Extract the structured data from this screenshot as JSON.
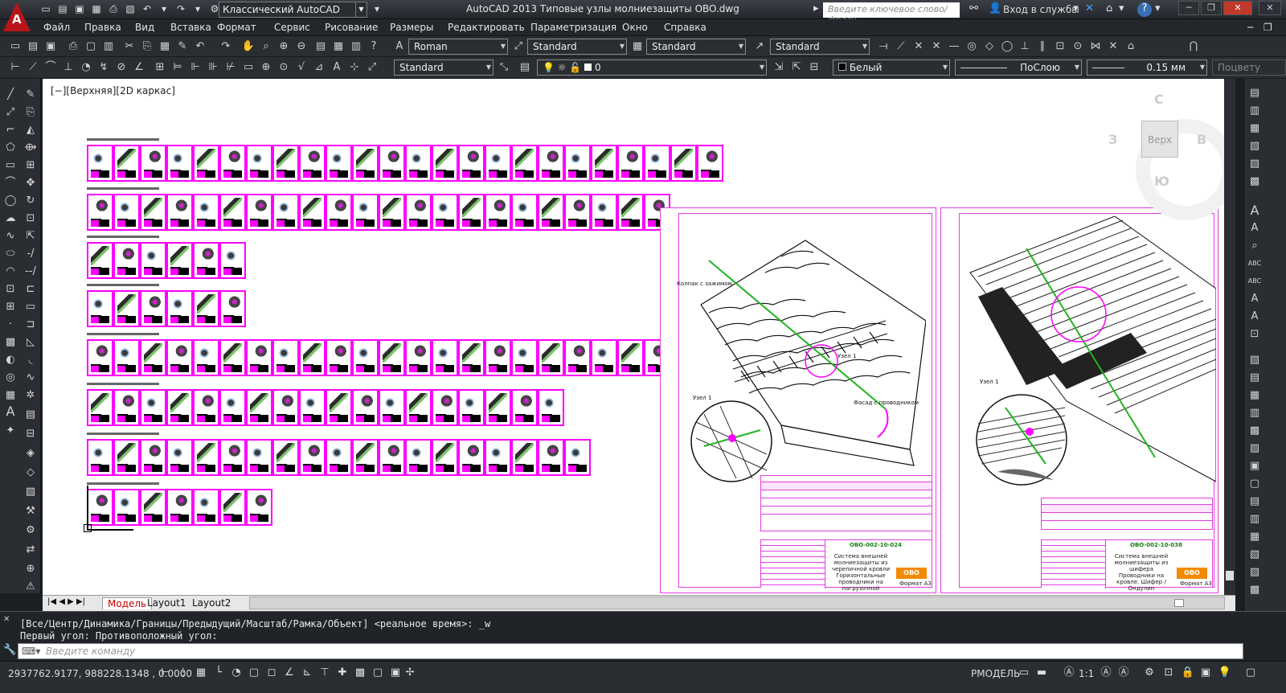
{
  "app": {
    "logo_letter": "A",
    "title": "AutoCAD 2013   Типовые узлы молниезащиты OBO.dwg",
    "workspace": "Классический AutoCAD",
    "search_placeholder": "Введите ключевое слово/фразу",
    "login": "Вход в службы"
  },
  "menu": [
    "Файл",
    "Правка",
    "Вид",
    "Вставка",
    "Формат",
    "Сервис",
    "Рисование",
    "Размеры",
    "Редактировать",
    "Параметризация",
    "Окно",
    "Справка"
  ],
  "styles": {
    "text_style": "Roman",
    "dim_style": "Standard",
    "table_style": "Standard",
    "mleader_style": "Standard",
    "visual_style": "Standard"
  },
  "layers": {
    "current": "0",
    "color": "Белый",
    "linetype": "ПоСлою",
    "lineweight": "0.15 мм",
    "plotstyle": "Поцвету"
  },
  "viewport": {
    "label": "[−][Верхняя][2D каркас]"
  },
  "viewcube": {
    "face": "Верх",
    "north": "С",
    "south": "Ю",
    "east": "В",
    "west": "З"
  },
  "sheets": {
    "left": {
      "code": "OBO-002-10-024",
      "title": "Система внешней молниезащиты из черепичной кровли",
      "sub": "Горизонтальные проводники на нагрузочной раскраске",
      "format": "Формат A3",
      "label_a": "Узел 1",
      "label_b": "Колпак с зажимом",
      "label_c": "Фасад с проводником",
      "label_d": "Узел 1"
    },
    "right": {
      "code": "OBO-002-10-038",
      "title": "Система внешней молниезащиты из шифера",
      "sub": "Проводники на кровле. Шифер / Ондулин",
      "format": "Формат A3",
      "label_a": "Узел 1"
    }
  },
  "tabs": {
    "model": "Модель",
    "layout1": "Layout1",
    "layout2": "Layout2"
  },
  "command": {
    "line1": "[Все/Центр/Динамика/Границы/Предыдущий/Масштаб/Рамка/Объект] <реальное время>: _w",
    "line2": "Первый угол: Противоположный угол:",
    "placeholder": "Введите команду"
  },
  "status": {
    "coords": "2937762.9177, 988228.1348 , 0.0000",
    "space": "РМОДЕЛЬ",
    "scale": "1:1"
  },
  "colors": {
    "accent": "#ff00ff",
    "bg": "#2a2e33"
  }
}
